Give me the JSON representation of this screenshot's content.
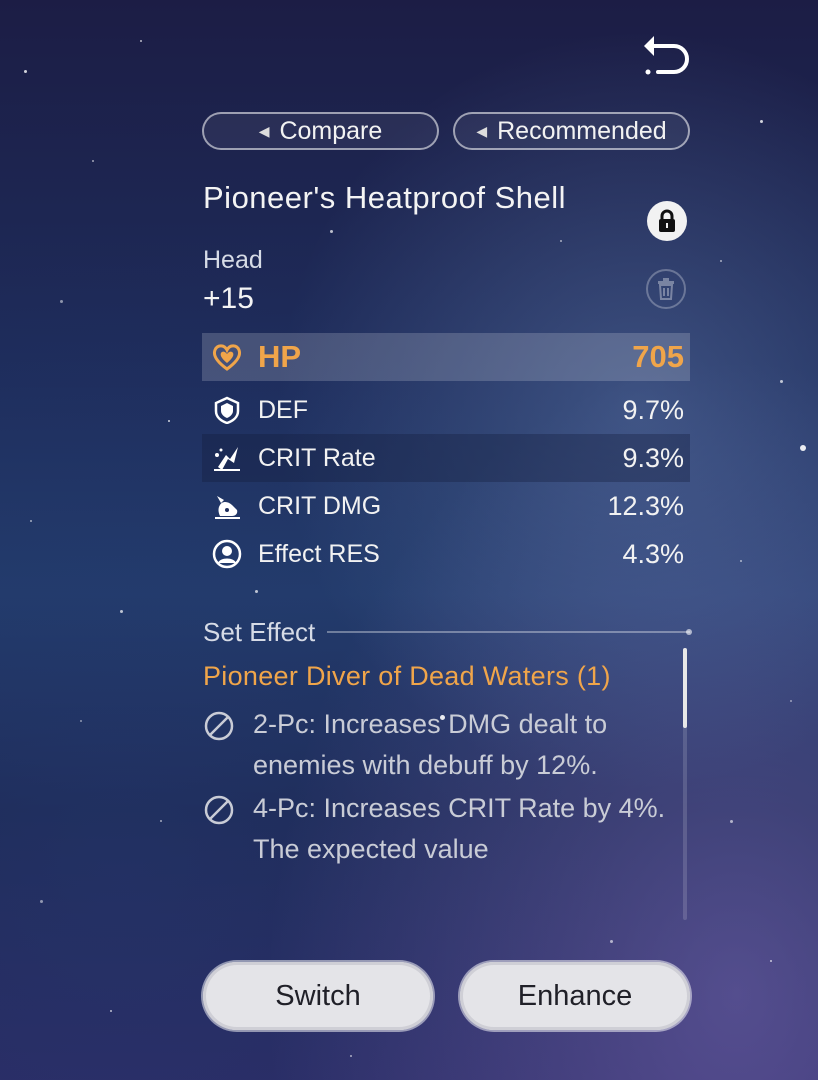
{
  "nav": {
    "back_icon": "return-arrow-icon"
  },
  "tabs": {
    "compare_label": "Compare",
    "recommended_label": "Recommended"
  },
  "relic": {
    "name": "Pioneer's Heatproof Shell",
    "slot": "Head",
    "level": "+15",
    "lock_icon": "lock-icon",
    "discard_icon": "trash-icon"
  },
  "main_stat": {
    "name": "HP",
    "value": "705",
    "icon": "heart-icon",
    "color": "#f0a54a"
  },
  "sub_stats": [
    {
      "name": "DEF",
      "value": "9.7%",
      "icon": "shield-icon"
    },
    {
      "name": "CRIT Rate",
      "value": "9.3%",
      "icon": "crit-rate-icon"
    },
    {
      "name": "CRIT DMG",
      "value": "12.3%",
      "icon": "crit-dmg-icon"
    },
    {
      "name": "Effect RES",
      "value": "4.3%",
      "icon": "effect-res-icon"
    }
  ],
  "set_effect": {
    "header": "Set Effect",
    "set_name": "Pioneer Diver of Dead Waters (1)",
    "bonuses": [
      {
        "text": "2-Pc: Increases DMG dealt to enemies with debuff by 12%.",
        "icon": "inactive-icon"
      },
      {
        "text": "4-Pc: Increases CRIT Rate by 4%. The expected value",
        "icon": "inactive-icon"
      }
    ]
  },
  "actions": {
    "switch_label": "Switch",
    "enhance_label": "Enhance"
  }
}
